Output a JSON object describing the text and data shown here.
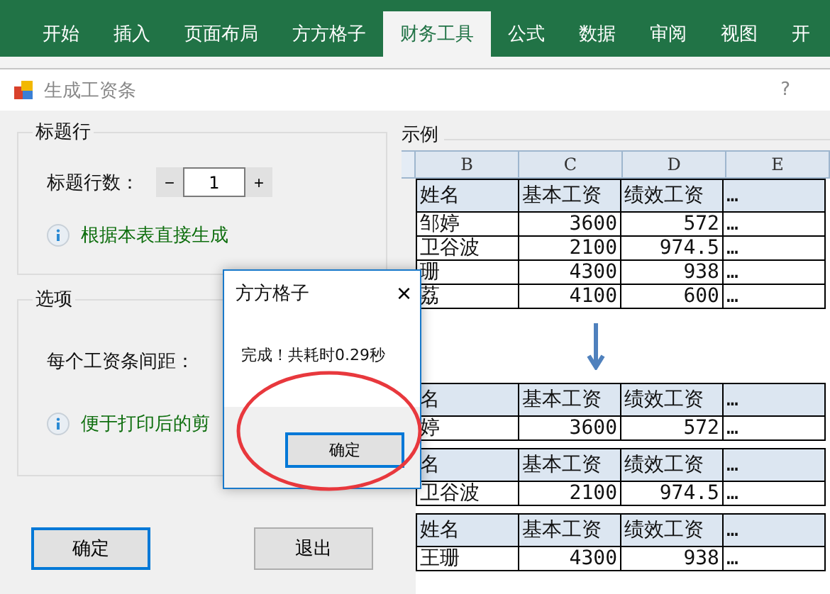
{
  "ribbon_tabs": [
    {
      "label": "开始",
      "selected": false
    },
    {
      "label": "插入",
      "selected": false
    },
    {
      "label": "页面布局",
      "selected": false
    },
    {
      "label": "方方格子",
      "selected": false
    },
    {
      "label": "财务工具",
      "selected": true
    },
    {
      "label": "公式",
      "selected": false
    },
    {
      "label": "数据",
      "selected": false
    },
    {
      "label": "审阅",
      "selected": false
    },
    {
      "label": "视图",
      "selected": false
    },
    {
      "label": "开",
      "selected": false
    }
  ],
  "dialog": {
    "title": "生成工资条",
    "help": "?"
  },
  "title_group": {
    "legend": "标题行",
    "label": "标题行数：",
    "minus": "−",
    "value": "1",
    "plus": "+",
    "info": "根据本表直接生成"
  },
  "options_group": {
    "legend": "选项",
    "label": "每个工资条间距：",
    "info": "便于打印后的剪"
  },
  "buttons": [
    {
      "label": "确定",
      "selected": true
    },
    {
      "label": "退出",
      "selected": false
    }
  ],
  "example": {
    "legend": "示例",
    "columns": [
      "B",
      "C",
      "D",
      "E"
    ],
    "table": {
      "header": [
        "姓名",
        "基本工资",
        "绩效工资",
        "…"
      ],
      "rows": [
        [
          "邹婷",
          "3600",
          "572",
          "…"
        ],
        [
          "卫谷波",
          "2100",
          "974.5",
          "…"
        ],
        [
          "珊",
          "4300",
          "938",
          "…"
        ],
        [
          "荔",
          "4100",
          "600",
          "…"
        ]
      ]
    },
    "result_tables": [
      {
        "header": [
          "名",
          "基本工资",
          "绩效工资",
          "…"
        ],
        "rows": [
          [
            "婷",
            "3600",
            "572",
            "…"
          ]
        ]
      },
      {
        "header": [
          "名",
          "基本工资",
          "绩效工资",
          "…"
        ],
        "rows": [
          [
            "卫谷波",
            "2100",
            "974.5",
            "…"
          ]
        ]
      },
      {
        "header": [
          "姓名",
          "基本工资",
          "绩效工资",
          "…"
        ],
        "rows": [
          [
            "王珊",
            "4300",
            "938",
            "…"
          ]
        ]
      }
    ]
  },
  "message_box": {
    "title": "方方格子",
    "close": "×",
    "message": "完成！共耗时0.29秒",
    "button": "确定"
  }
}
